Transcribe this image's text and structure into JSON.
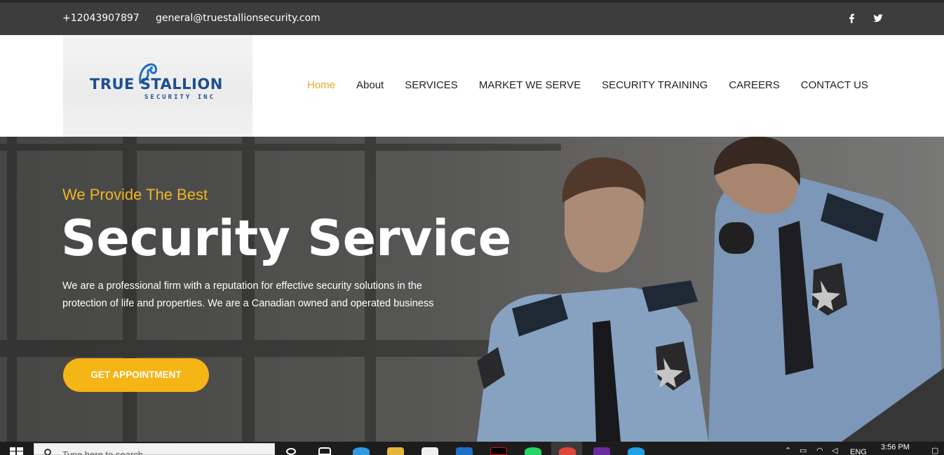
{
  "topbar": {
    "phone": "+12043907897",
    "email": "general@truestallionsecurity.com",
    "social": [
      {
        "name": "facebook-icon",
        "glyph": "f"
      },
      {
        "name": "twitter-icon",
        "glyph": "🐦"
      }
    ]
  },
  "logo": {
    "title": "TRUE STALLION",
    "subtitle": "SECURITY INC"
  },
  "nav": {
    "items": [
      {
        "label": "Home",
        "active": true
      },
      {
        "label": "About",
        "active": false
      },
      {
        "label": "SERVICES",
        "active": false
      },
      {
        "label": "MARKET WE SERVE",
        "active": false
      },
      {
        "label": "SECURITY TRAINING",
        "active": false
      },
      {
        "label": "CAREERS",
        "active": false
      },
      {
        "label": "CONTACT US",
        "active": false
      }
    ]
  },
  "hero": {
    "kicker": "We Provide The Best",
    "title": "Security Service",
    "description": "We are a professional firm with a reputation for effective security solutions in the protection of life and properties. We are a Canadian owned and operated business",
    "cta": "GET APPOINTMENT"
  },
  "taskbar": {
    "search_placeholder": "Type here to search",
    "language": "ENG",
    "time": "3:56 PM"
  },
  "colors": {
    "accent": "#f5b515",
    "nav_active": "#e8a830",
    "logo_blue": "#1d4f91",
    "topbar_bg": "#3d3d3d"
  }
}
